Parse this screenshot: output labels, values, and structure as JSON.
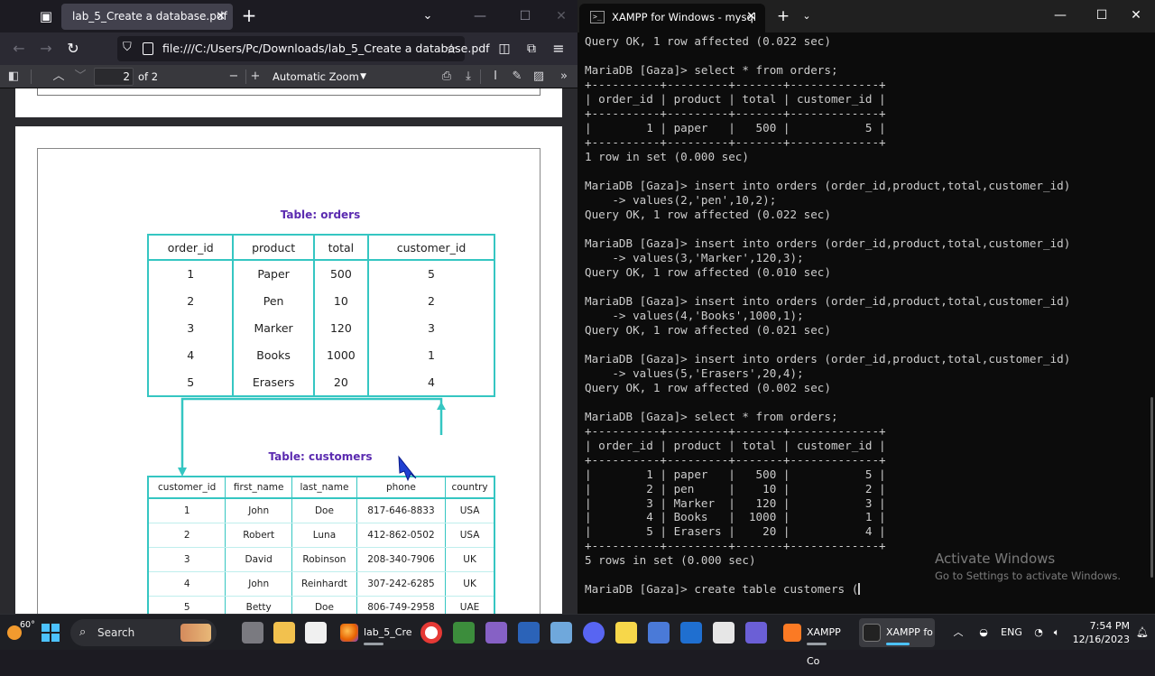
{
  "firefox": {
    "tab_title": "lab_5_Create a database.pdf",
    "url": "file:///C:/Users/Pc/Downloads/lab_5_Create a database.pdf",
    "pdf_toolbar": {
      "page_number": "2",
      "page_count": "of 2",
      "zoom": "Automatic Zoom"
    }
  },
  "pdf": {
    "orders_caption": "Table: orders",
    "orders_columns": [
      "order_id",
      "product",
      "total",
      "customer_id"
    ],
    "orders_rows": [
      [
        "1",
        "Paper",
        "500",
        "5"
      ],
      [
        "2",
        "Pen",
        "10",
        "2"
      ],
      [
        "3",
        "Marker",
        "120",
        "3"
      ],
      [
        "4",
        "Books",
        "1000",
        "1"
      ],
      [
        "5",
        "Erasers",
        "20",
        "4"
      ]
    ],
    "customers_caption": "Table: customers",
    "customers_columns": [
      "customer_id",
      "first_name",
      "last_name",
      "phone",
      "country"
    ],
    "customers_rows": [
      [
        "1",
        "John",
        "Doe",
        "817-646-8833",
        "USA"
      ],
      [
        "2",
        "Robert",
        "Luna",
        "412-862-0502",
        "USA"
      ],
      [
        "3",
        "David",
        "Robinson",
        "208-340-7906",
        "UK"
      ],
      [
        "4",
        "John",
        "Reinhardt",
        "307-242-6285",
        "UK"
      ],
      [
        "5",
        "Betty",
        "Doe",
        "806-749-2958",
        "UAE"
      ]
    ]
  },
  "terminal": {
    "tab_title": "XAMPP for Windows - mysql",
    "lines": [
      "Query OK, 1 row affected (0.022 sec)",
      "",
      "MariaDB [Gaza]> select * from orders;",
      "+----------+---------+-------+-------------+",
      "| order_id | product | total | customer_id |",
      "+----------+---------+-------+-------------+",
      "|        1 | paper   |   500 |           5 |",
      "+----------+---------+-------+-------------+",
      "1 row in set (0.000 sec)",
      "",
      "MariaDB [Gaza]> insert into orders (order_id,product,total,customer_id)",
      "    -> values(2,'pen',10,2);",
      "Query OK, 1 row affected (0.022 sec)",
      "",
      "MariaDB [Gaza]> insert into orders (order_id,product,total,customer_id)",
      "    -> values(3,'Marker',120,3);",
      "Query OK, 1 row affected (0.010 sec)",
      "",
      "MariaDB [Gaza]> insert into orders (order_id,product,total,customer_id)",
      "    -> values(4,'Books',1000,1);",
      "Query OK, 1 row affected (0.021 sec)",
      "",
      "MariaDB [Gaza]> insert into orders (order_id,product,total,customer_id)",
      "    -> values(5,'Erasers',20,4);",
      "Query OK, 1 row affected (0.002 sec)",
      "",
      "MariaDB [Gaza]> select * from orders;",
      "+----------+---------+-------+-------------+",
      "| order_id | product | total | customer_id |",
      "+----------+---------+-------+-------------+",
      "|        1 | paper   |   500 |           5 |",
      "|        2 | pen     |    10 |           2 |",
      "|        3 | Marker  |   120 |           3 |",
      "|        4 | Books   |  1000 |           1 |",
      "|        5 | Erasers |    20 |           4 |",
      "+----------+---------+-------+-------------+",
      "5 rows in set (0.000 sec)",
      ""
    ],
    "current_input": "MariaDB [Gaza]> create table customers ("
  },
  "watermark": {
    "title": "Activate Windows",
    "subtitle": "Go to Settings to activate Windows."
  },
  "taskbar": {
    "temperature": "60°",
    "search_label": "Search",
    "apps": [
      {
        "label": "lab_5_Cre",
        "icon": "firefox-icon"
      },
      {
        "label": "XAMPP Co",
        "icon": "xampp-icon"
      },
      {
        "label": "XAMPP fo",
        "icon": "terminal-icon"
      }
    ],
    "language": "ENG",
    "time": "7:54 PM",
    "date": "12/16/2023"
  }
}
